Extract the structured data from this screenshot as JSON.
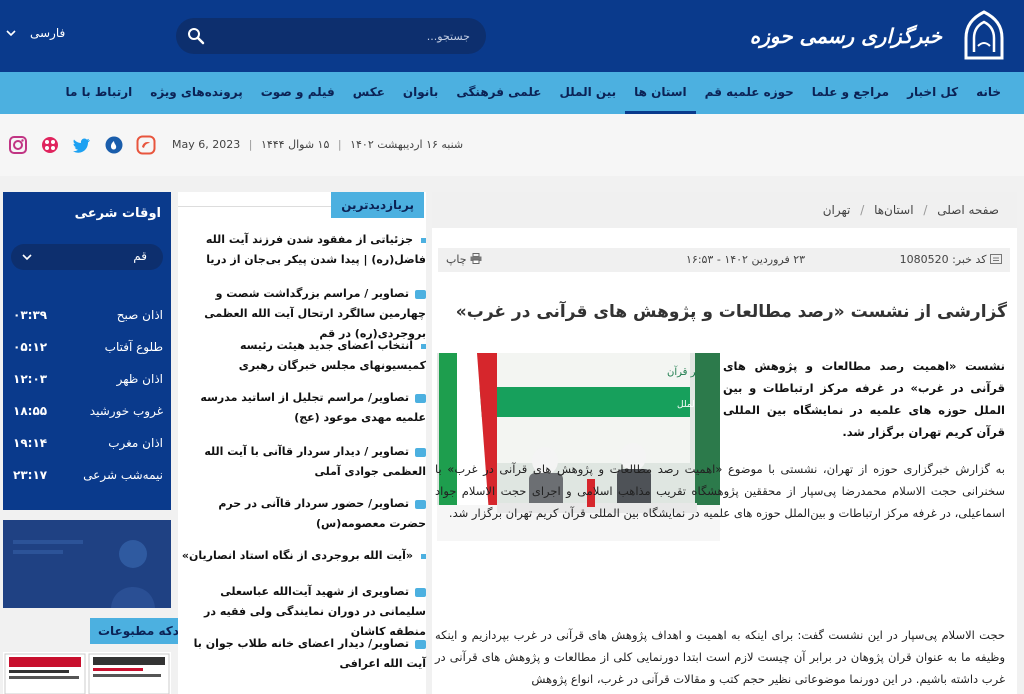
{
  "header": {
    "logo_text": "خبرگزاری رسمی حوزه",
    "search_placeholder": "جستجو...",
    "language": "فارسی"
  },
  "nav": {
    "items": [
      "خانه",
      "کل اخبار",
      "مراجع و علما",
      "حوزه علمیه قم",
      "استان ها",
      "بین الملل",
      "علمی فرهنگی",
      "بانوان",
      "عکس",
      "فیلم و صوت",
      "پرونده‌های ویژه",
      "ارتباط با ما"
    ],
    "active_index": 4
  },
  "date_bar": {
    "persian": "شنبه ۱۶ اردیبهشت ۱۴۰۲",
    "hijri": "۱۵ شوال ۱۴۴۴",
    "gregorian": "May 6, 2023",
    "social_icons": [
      "instagram-icon",
      "aparat-icon",
      "twitter-icon",
      "eitaa-icon",
      "soroush-icon"
    ]
  },
  "prayer": {
    "title": "اوقات شرعی",
    "city": "قم",
    "rows": [
      {
        "label": "اذان صبح",
        "time": "۰۳:۳۹"
      },
      {
        "label": "طلوع آفتاب",
        "time": "۰۵:۱۲"
      },
      {
        "label": "اذان ظهر",
        "time": "۱۲:۰۳"
      },
      {
        "label": "غروب خورشید",
        "time": "۱۸:۵۵"
      },
      {
        "label": "اذان مغرب",
        "time": "۱۹:۱۴"
      },
      {
        "label": "نیمه‌شب شرعی",
        "time": "۲۳:۱۷"
      }
    ]
  },
  "journals": {
    "title": "دکه مطبوعات"
  },
  "most_visited": {
    "title": "پربازدیدترین",
    "items": [
      {
        "text": "جزئیاتی از مفقود شدن فرزند آیت الله فاضل(ره) | پیدا شدن پیکر بی‌جان از دریا",
        "type": "text"
      },
      {
        "text": "تصاویر / مراسم بزرگداشت شصت و چهارمین سالگرد ارتحال آیت الله العظمی بروجردی(ره) در قم",
        "type": "photo"
      },
      {
        "text": "انتخاب اعضای جدید هیئت رئیسه کمیسیونهای مجلس خبرگان رهبری",
        "type": "text"
      },
      {
        "text": "تصاویر/ مراسم تجلیل از اساتید مدرسه علمیه مهدی موعود (عج)",
        "type": "photo"
      },
      {
        "text": "تصاویر / دیدار سردار قاآنی با آیت الله العظمی جوادی آملی",
        "type": "photo"
      },
      {
        "text": "تصاویر/ حضور سردار قاآنی در حرم حضرت معصومه(س)",
        "type": "photo"
      },
      {
        "text": "«آیت الله بروجردی از نگاه استاد انصاریان»",
        "type": "text"
      },
      {
        "text": "تصاویری از شهید آیت‌الله عباسعلی سلیمانی در دوران نمایندگی ولی فقیه در منطقه کاشان",
        "type": "photo"
      },
      {
        "text": "تصاویر/ دیدار اعضای خانه طلاب جوان با آیت الله اعرافی",
        "type": "photo"
      }
    ]
  },
  "article": {
    "breadcrumb": [
      "صفحه اصلی",
      "استان‌ها",
      "تهران"
    ],
    "news_id_label": "کد خبر: 1080520",
    "pub_date": "۲۳ فروردین ۱۴۰۲ - ۱۶:۵۳",
    "print_label": "چاپ",
    "headline": "گزارشی از نشست «رصد مطالعات و پژوهش های قرآنی در غرب»",
    "photo_caption_title": "در محضر قرآن",
    "photo_caption_sub": "سلسله نشست‌های تخصصی قرآنی در عرصه بین الملل",
    "lead": "نشست «اهمیت رصد مطالعات و پژوهش های قرآنی در غرب» در غرفه مرکز ارتباطات و بین الملل حوزه های علمیه در نمایشگاه بین المللی قرآن کریم تهران برگزار شد.",
    "para1": "به گزارش خبرگزاری حوزه از تهران، نشستی با موضوع «اهمیت رصد مطالعات و پژوهش های قرآنی در غرب» با سخنرانی حجت الاسلام محمدرضا پی‌سپار از محققین پژوهشگاه تقریب مذاهب اسلامی و اجرای حجت الاسلام جواد اسماعیلی، در غرفه مرکز ارتباطات و بین‌الملل حوزه های علمیه در نمایشگاه بین المللی قرآن کریم تهران برگزار شد.",
    "para2": "حجت الاسلام پی‌سپار در این نشست گفت: برای اینکه به اهمیت و اهداف پژوهش های قرآنی در غرب بپردازیم و اینکه وظیفه ما به عنوان قران پژوهان در برابر آن چیست لازم است ابتدا دورنمایی کلی از مطالعات و پژوهش های قرآنی در غرب داشته باشیم. در این دورنما موضوعاتی نظیر حجم کتب و مقالات قرآنی در غرب، انواع پژوهش"
  }
}
